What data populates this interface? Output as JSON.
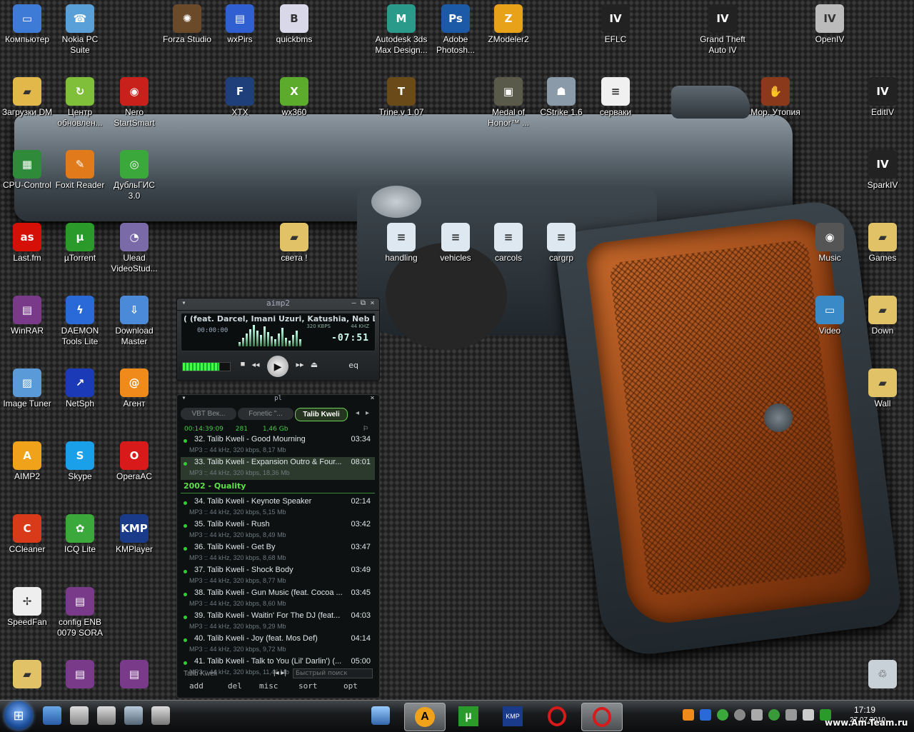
{
  "desktop": {
    "icons": [
      {
        "label": "Компьютер",
        "icon": "computer-icon",
        "color": "#3d7bd6",
        "glyph": "▭"
      },
      {
        "label": "Nokia PC Suite",
        "icon": "nokia-pc-suite-icon",
        "color": "#5aa0d8",
        "glyph": "☎"
      },
      {
        "label": "Forza Studio",
        "icon": "forza-studio-icon",
        "color": "#6b4a2a",
        "glyph": "✺"
      },
      {
        "label": "wxPirs",
        "icon": "wxpirs-icon",
        "color": "#2f5fd0",
        "glyph": "▤"
      },
      {
        "label": "quickbms",
        "icon": "quickbms-icon",
        "color": "#d8d8e8",
        "glyph": "B"
      },
      {
        "label": "Autodesk 3ds Max Design...",
        "icon": "autodesk-3ds-max-icon",
        "color": "#2a9b8a",
        "glyph": "M"
      },
      {
        "label": "Adobe Photosh...",
        "icon": "adobe-photoshop-icon",
        "color": "#1c5aa8",
        "glyph": "Ps"
      },
      {
        "label": "ZModeler2",
        "icon": "zmodeler-icon",
        "color": "#e8a21a",
        "glyph": "Z"
      },
      {
        "label": "EFLC",
        "icon": "gta-iv-eflc-icon",
        "color": "#222222",
        "glyph": "IV"
      },
      {
        "label": "Grand Theft Auto IV",
        "icon": "gta-iv-icon",
        "color": "#222222",
        "glyph": "IV"
      },
      {
        "label": "OpenIV",
        "icon": "openiv-icon",
        "color": "#bbbbbb",
        "glyph": "IV"
      },
      {
        "label": "Загрузки DM",
        "icon": "downloads-folder-icon",
        "color": "#e2b84a",
        "glyph": "▰"
      },
      {
        "label": "Центр обновлен...",
        "icon": "update-center-icon",
        "color": "#7fbf3a",
        "glyph": "↻"
      },
      {
        "label": "Nero StartSmart",
        "icon": "nero-icon",
        "color": "#c8201a",
        "glyph": "◉"
      },
      {
        "label": "XTX",
        "icon": "xtx-icon",
        "color": "#1e3f7a",
        "glyph": "F"
      },
      {
        "label": "wx360",
        "icon": "wx360-icon",
        "color": "#5cab2c",
        "glyph": "X"
      },
      {
        "label": "Trine.v 1.07",
        "icon": "trine-icon",
        "color": "#6b4a1a",
        "glyph": "T"
      },
      {
        "label": "Medal of Honor™ ...",
        "icon": "medal-of-honor-icon",
        "color": "#5a5a4a",
        "glyph": "▣"
      },
      {
        "label": "CStrike 1.6",
        "icon": "counter-strike-icon",
        "color": "#8a9aa8",
        "glyph": "☗"
      },
      {
        "label": "серваки",
        "icon": "text-file-icon",
        "color": "#f0f0f0",
        "glyph": "≡"
      },
      {
        "label": "Мор. Утопия",
        "icon": "pathologic-icon",
        "color": "#8a3a1a",
        "glyph": "✋"
      },
      {
        "label": "EditIV",
        "icon": "editiv-icon",
        "color": "#222222",
        "glyph": "IV"
      },
      {
        "label": "CPU-Control",
        "icon": "cpu-control-icon",
        "color": "#2f8a3a",
        "glyph": "▦"
      },
      {
        "label": "Foxit Reader",
        "icon": "foxit-reader-icon",
        "color": "#e07a1a",
        "glyph": "✎"
      },
      {
        "label": "ДубльГИС 3.0",
        "icon": "2gis-icon",
        "color": "#3aa83a",
        "glyph": "◎"
      },
      {
        "label": "SparkIV",
        "icon": "sparkiv-icon",
        "color": "#222222",
        "glyph": "IV"
      },
      {
        "label": "Last.fm",
        "icon": "lastfm-icon",
        "color": "#d51007",
        "glyph": "as"
      },
      {
        "label": "µTorrent",
        "icon": "utorrent-icon",
        "color": "#2a9a2a",
        "glyph": "µ"
      },
      {
        "label": "Ulead VideoStud...",
        "icon": "ulead-video-studio-icon",
        "color": "#7a6aa8",
        "glyph": "◔"
      },
      {
        "label": "света !",
        "icon": "folder-icon",
        "color": "#e2c266",
        "glyph": "▰"
      },
      {
        "label": "handling",
        "icon": "document-icon",
        "color": "#dde8f0",
        "glyph": "≡"
      },
      {
        "label": "vehicles",
        "icon": "document-icon",
        "color": "#dde8f0",
        "glyph": "≡"
      },
      {
        "label": "carcols",
        "icon": "document-icon",
        "color": "#dde8f0",
        "glyph": "≡"
      },
      {
        "label": "cargrp",
        "icon": "document-icon",
        "color": "#dde8f0",
        "glyph": "≡"
      },
      {
        "label": "Music",
        "icon": "music-folder-icon",
        "color": "#555555",
        "glyph": "◉"
      },
      {
        "label": "Games",
        "icon": "folder-icon",
        "color": "#e2c266",
        "glyph": "▰"
      },
      {
        "label": "WinRAR",
        "icon": "winrar-icon",
        "color": "#7a3a8a",
        "glyph": "▤"
      },
      {
        "label": "DAEMON Tools Lite",
        "icon": "daemon-tools-icon",
        "color": "#2a6ad8",
        "glyph": "ϟ"
      },
      {
        "label": "Download Master",
        "icon": "download-master-icon",
        "color": "#4a8ad8",
        "glyph": "⇩"
      },
      {
        "label": "Video",
        "icon": "video-folder-icon",
        "color": "#3a8ac8",
        "glyph": "▭"
      },
      {
        "label": "Down",
        "icon": "folder-icon",
        "color": "#e2c266",
        "glyph": "▰"
      },
      {
        "label": "Image Tuner",
        "icon": "image-tuner-icon",
        "color": "#5a9ad8",
        "glyph": "▨"
      },
      {
        "label": "NetSph",
        "icon": "netsph-icon",
        "color": "#1a3ab8",
        "glyph": "↗"
      },
      {
        "label": "Агент",
        "icon": "mail-agent-icon",
        "color": "#f08a1a",
        "glyph": "@"
      },
      {
        "label": "Wall",
        "icon": "wall-folder-icon",
        "color": "#e2c266",
        "glyph": "▰"
      },
      {
        "label": "AIMP2",
        "icon": "aimp2-icon",
        "color": "#f0a21a",
        "glyph": "A"
      },
      {
        "label": "Skype",
        "icon": "skype-icon",
        "color": "#1aa0e8",
        "glyph": "S"
      },
      {
        "label": "OperaAC",
        "icon": "opera-icon",
        "color": "#d81a1a",
        "glyph": "O"
      },
      {
        "label": "CCleaner",
        "icon": "ccleaner-icon",
        "color": "#d83a1a",
        "glyph": "C"
      },
      {
        "label": "ICQ Lite",
        "icon": "icq-icon",
        "color": "#3aa83a",
        "glyph": "✿"
      },
      {
        "label": "KMPlayer",
        "icon": "kmplayer-icon",
        "color": "#1a3a8a",
        "glyph": "KMP"
      },
      {
        "label": "SpeedFan",
        "icon": "speedfan-icon",
        "color": "#eeeeee",
        "glyph": "✢"
      },
      {
        "label": "config ENB 0079 SORA",
        "icon": "winrar-archive-icon",
        "color": "#7a3a8a",
        "glyph": "▤"
      },
      {
        "label": "",
        "icon": "folder-icon",
        "color": "#e2c266",
        "glyph": "▰"
      },
      {
        "label": "",
        "icon": "winrar-archive-icon",
        "color": "#7a3a8a",
        "glyph": "▤"
      },
      {
        "label": "",
        "icon": "winrar-archive-icon",
        "color": "#7a3a8a",
        "glyph": "▤"
      },
      {
        "label": "",
        "icon": "recycle-bin-icon",
        "color": "#c8d0d8",
        "glyph": "♲"
      }
    ]
  },
  "aimp": {
    "title": "aimp2",
    "marquee": "( (feat. Darcel, Imani Uzuri, Katushia, Neb Luv, Tiye Ph",
    "time": "00:00:00",
    "kbps": "320 KBPS",
    "khz": "44 KHZ",
    "digits": "-07:51",
    "eq_label": "eq",
    "volume": 0.78
  },
  "playlist": {
    "title": "pl",
    "tabs": [
      "VBT Век...",
      "Fonetic \"...",
      "Talib Kweli"
    ],
    "active_tab": 2,
    "total_time": "00:14:39:09",
    "count": "281",
    "size": "1,46 Gb",
    "tracks_a": [
      {
        "num": "32.",
        "title": "Talib Kweli - Good Mourning",
        "dur": "03:34",
        "info": "MP3 :: 44 kHz, 320 kbps, 8,17 Mb"
      },
      {
        "num": "33.",
        "title": "Talib Kweli - Expansion Outro & Four...",
        "dur": "08:01",
        "info": "MP3 :: 44 kHz, 320 kbps, 18,36 Mb"
      }
    ],
    "group": "2002 - Quality",
    "tracks_b": [
      {
        "num": "34.",
        "title": "Talib Kweli - Keynote Speaker",
        "dur": "02:14",
        "info": "MP3 :: 44 kHz, 320 kbps, 5,15 Mb"
      },
      {
        "num": "35.",
        "title": "Talib Kweli - Rush",
        "dur": "03:42",
        "info": "MP3 :: 44 kHz, 320 kbps, 8,49 Mb"
      },
      {
        "num": "36.",
        "title": "Talib Kweli - Get By",
        "dur": "03:47",
        "info": "MP3 :: 44 kHz, 320 kbps, 8,68 Mb"
      },
      {
        "num": "37.",
        "title": "Talib Kweli - Shock Body",
        "dur": "03:49",
        "info": "MP3 :: 44 kHz, 320 kbps, 8,77 Mb"
      },
      {
        "num": "38.",
        "title": "Talib Kweli - Gun Music (feat. Cocoa ...",
        "dur": "03:45",
        "info": "MP3 :: 44 kHz, 320 kbps, 8,60 Mb"
      },
      {
        "num": "39.",
        "title": "Talib Kweli - Waitin' For The DJ (feat...",
        "dur": "04:03",
        "info": "MP3 :: 44 kHz, 320 kbps, 9,29 Mb"
      },
      {
        "num": "40.",
        "title": "Talib Kweli - Joy (feat. Mos Def)",
        "dur": "04:14",
        "info": "MP3 :: 44 kHz, 320 kbps, 9,72 Mb"
      },
      {
        "num": "41.",
        "title": "Talib Kweli - Talk to You (Lil' Darlin') (...",
        "dur": "05:00",
        "info": "MP3 :: 44 kHz, 320 kbps, 11,46 Mb"
      }
    ],
    "current": "Talib Kweli",
    "search_placeholder": "Быстрый поиск",
    "menu": [
      "add",
      "del",
      "misc",
      "sort",
      "opt"
    ]
  },
  "taskbar": {
    "clock": "17:19",
    "date": "27.07.2010",
    "watermark": "www.Am-Team.ru"
  }
}
